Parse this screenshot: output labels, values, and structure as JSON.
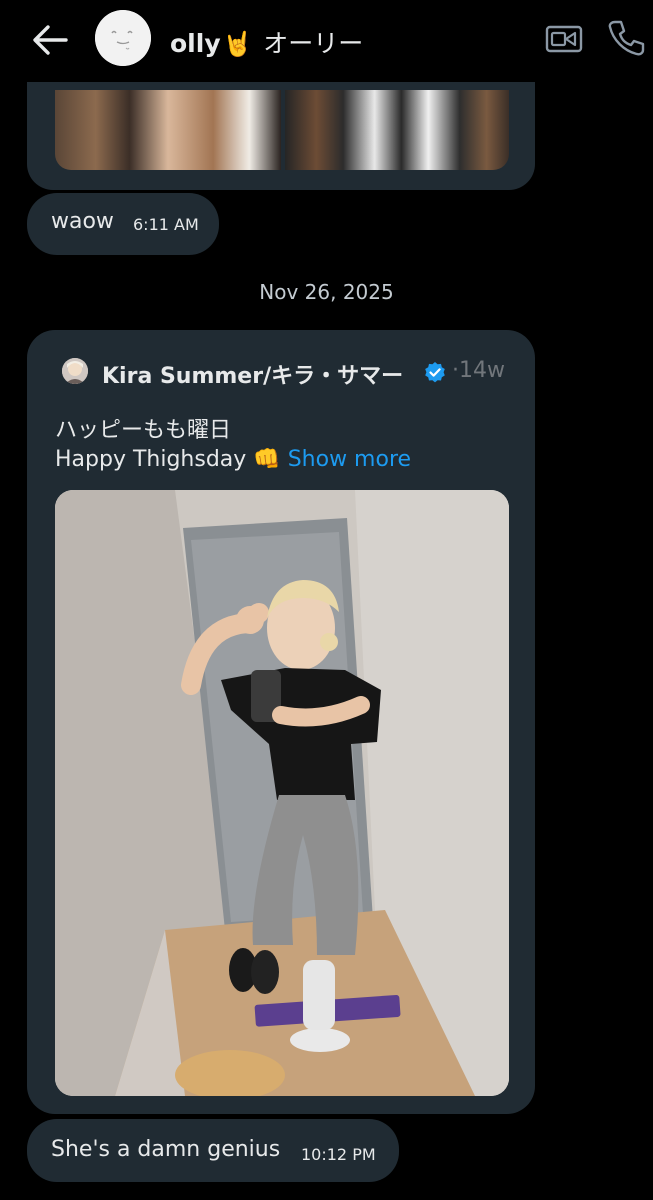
{
  "header": {
    "name": "olly",
    "emoji": "🤘",
    "name_jp": "オーリー",
    "back_icon": "arrow-left-icon",
    "video_icon": "video-call-icon",
    "phone_icon": "phone-icon"
  },
  "messages": {
    "first": {
      "text": "waow",
      "time": "6:11 AM"
    },
    "date_divider": "Nov 26, 2025",
    "shared_post": {
      "author": "Kira Summer/キラ・サマー",
      "age": "14w",
      "text_line1": "ハッピーもも曜日",
      "text_line2": "Happy Thighsday",
      "emoji": "👊",
      "show_more": "Show more"
    },
    "last": {
      "text": "She's a damn genius",
      "time": "10:12 PM"
    }
  },
  "colors": {
    "background": "#000000",
    "bubble": "#202b33",
    "text": "#e7e9ea",
    "muted": "#71767b",
    "link": "#1d9bf0",
    "verified": "#1d9bf0"
  }
}
